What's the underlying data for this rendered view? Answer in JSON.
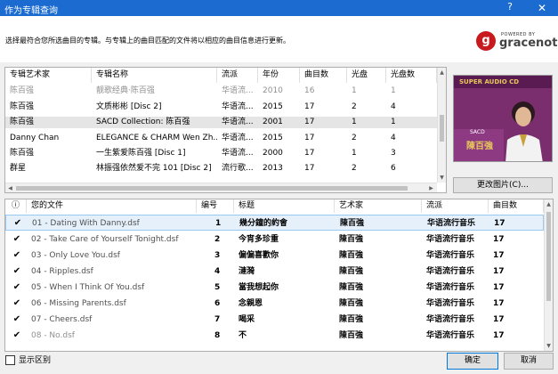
{
  "window": {
    "title": "作为专辑查询",
    "help_glyph": "?",
    "close_glyph": "✕"
  },
  "description": "选择最符合您所选曲目的专辑。与专辑上的曲目匹配的文件将以相应的曲目信息进行更新。",
  "logo": {
    "powered_by": "POWERED BY",
    "name": "gracenote.",
    "brand_color": "#c8191f"
  },
  "album_table": {
    "columns": [
      "专辑艺术家",
      "专辑名称",
      "流派",
      "年份",
      "曲目数",
      "光盘",
      "光盘数"
    ],
    "rows": [
      [
        "陈百强",
        "靓歌经典·陈百强",
        "华语流...",
        "2010",
        "16",
        "1",
        "1"
      ],
      [
        "陈百强",
        "文质彬彬 [Disc 2]",
        "华语流...",
        "2015",
        "17",
        "2",
        "4"
      ],
      [
        "陈百强",
        "SACD Collection: 陈百强",
        "华语流...",
        "2001",
        "17",
        "1",
        "1"
      ],
      [
        "Danny Chan",
        "ELEGANCE & CHARM Wen Zh...",
        "华语流...",
        "2015",
        "17",
        "2",
        "4"
      ],
      [
        "陈百强",
        "一生紫爱陈百强 [Disc 1]",
        "华语流...",
        "2000",
        "17",
        "1",
        "3"
      ],
      [
        "群星",
        "林振强依然爱不完 101 [Disc 2]",
        "流行歌...",
        "2013",
        "17",
        "2",
        "6"
      ]
    ],
    "selected_index": 2
  },
  "cover": {
    "top_text": "SUPER AUDIO CD",
    "small_label": "SACD",
    "artist": "陳百強",
    "background_color": "#7a2e6e"
  },
  "change_picture_button": "更改图片(C)...",
  "track_table": {
    "columns": [
      "ⓘ",
      "您的文件",
      "编号",
      "标题",
      "艺术家",
      "流派",
      "曲目数"
    ],
    "rows": [
      {
        "checked": true,
        "file": "01 - Dating With Danny.dsf",
        "num": "1",
        "title": "幾分鐘的約會",
        "artist": "陳百強",
        "genre": "华语流行音乐",
        "count": "17"
      },
      {
        "checked": true,
        "file": "02 - Take Care of Yourself Tonight.dsf",
        "num": "2",
        "title": "今宵多珍重",
        "artist": "陳百強",
        "genre": "华语流行音乐",
        "count": "17"
      },
      {
        "checked": true,
        "file": "03 - Only Love You.dsf",
        "num": "3",
        "title": "偏偏喜歡你",
        "artist": "陳百強",
        "genre": "华语流行音乐",
        "count": "17"
      },
      {
        "checked": true,
        "file": "04 - Ripples.dsf",
        "num": "4",
        "title": "漣漪",
        "artist": "陳百強",
        "genre": "华语流行音乐",
        "count": "17"
      },
      {
        "checked": true,
        "file": "05 - When I Think Of You.dsf",
        "num": "5",
        "title": "當我想起你",
        "artist": "陳百強",
        "genre": "华语流行音乐",
        "count": "17"
      },
      {
        "checked": true,
        "file": "06 - Missing Parents.dsf",
        "num": "6",
        "title": "念親恩",
        "artist": "陳百強",
        "genre": "华语流行音乐",
        "count": "17"
      },
      {
        "checked": true,
        "file": "07 - Cheers.dsf",
        "num": "7",
        "title": "喝采",
        "artist": "陳百強",
        "genre": "华语流行音乐",
        "count": "17"
      },
      {
        "checked": true,
        "file": "08 - No.dsf",
        "num": "8",
        "title": "不",
        "artist": "陳百強",
        "genre": "华语流行音乐",
        "count": "17"
      }
    ],
    "selected_index": 0
  },
  "show_diff": {
    "label": "显示区别",
    "checked": false
  },
  "buttons": {
    "ok": "确定",
    "cancel": "取消"
  }
}
